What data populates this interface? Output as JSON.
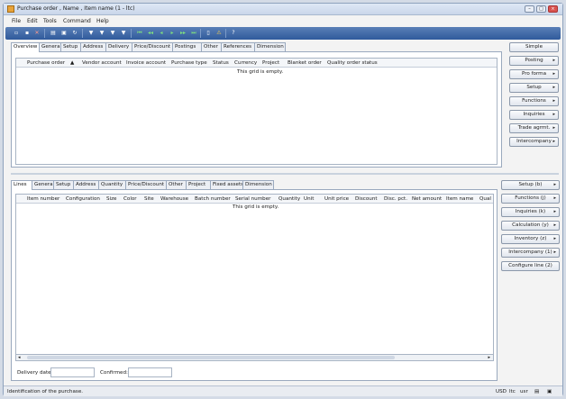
{
  "window": {
    "title": "Purchase order , Name , Item name (1 - ltc)",
    "controls": [
      "–",
      "□",
      "×"
    ]
  },
  "menu": [
    "File",
    "Edit",
    "Tools",
    "Command",
    "Help"
  ],
  "toolbar_icons": [
    "new-icon",
    "save-icon",
    "delete-icon",
    "print-icon",
    "print-preview-icon",
    "refresh-icon",
    "filter-icon",
    "filter-by-selection-icon",
    "advanced-filter-icon",
    "sort-icon",
    "first-record-icon",
    "previous-page-icon",
    "previous-record-icon",
    "next-record-icon",
    "next-page-icon",
    "last-record-icon",
    "attachment-icon",
    "alert-icon",
    "help-icon"
  ],
  "header_tabs": [
    "Overview",
    "General",
    "Setup",
    "Address",
    "Delivery",
    "Price/Discount",
    "Postings",
    "Other",
    "References",
    "Dimension"
  ],
  "header_grid": {
    "columns": [
      "Purchase order",
      "▲",
      "Vendor account",
      "Invoice account",
      "Purchase type",
      "Status",
      "Currency",
      "Project",
      "Blanket order",
      "Quality order status"
    ],
    "empty_text": "This grid is empty."
  },
  "header_buttons": [
    {
      "label": "Simple",
      "arrow": false
    },
    {
      "label": "Posting",
      "arrow": true
    },
    {
      "label": "Pro forma",
      "arrow": true
    },
    {
      "label": "Setup",
      "arrow": true
    },
    {
      "label": "Functions",
      "arrow": true
    },
    {
      "label": "Inquiries",
      "arrow": true
    },
    {
      "label": "Trade agrmt.",
      "arrow": true
    },
    {
      "label": "Intercompany",
      "arrow": true
    }
  ],
  "lines_tabs": [
    "Lines",
    "General",
    "Setup",
    "Address",
    "Quantity",
    "Price/Discount",
    "Other",
    "Project",
    "Fixed assets",
    "Dimension"
  ],
  "lines_grid": {
    "columns": [
      "Item number",
      "Configuration",
      "Size",
      "Color",
      "Site",
      "Warehouse",
      "Batch number",
      "Serial number",
      "Quantity",
      "Unit",
      "Unit price",
      "Discount",
      "Disc. pct.",
      "Net amount",
      "Item name",
      "Qual"
    ],
    "empty_text": "This grid is empty."
  },
  "lines_buttons": [
    {
      "label": "Setup (b)",
      "arrow": true
    },
    {
      "label": "Functions (j)",
      "arrow": true
    },
    {
      "label": "Inquiries (k)",
      "arrow": true
    },
    {
      "label": "Calculation (y)",
      "arrow": true
    },
    {
      "label": "Inventory (z)",
      "arrow": true
    },
    {
      "label": "Intercompany (1)",
      "arrow": true
    },
    {
      "label": "Configure line (2)",
      "arrow": false
    }
  ],
  "fields": {
    "delivery_date_label": "Delivery date:",
    "delivery_date_value": "",
    "confirmed_label": "Confirmed:",
    "confirmed_value": ""
  },
  "status": {
    "message": "Identification of the purchase.",
    "currency": "USD",
    "company": "ltc",
    "user": "usr"
  },
  "colors": {
    "toolbar": "#2f5a9c",
    "accent": "#5a7fb6"
  }
}
